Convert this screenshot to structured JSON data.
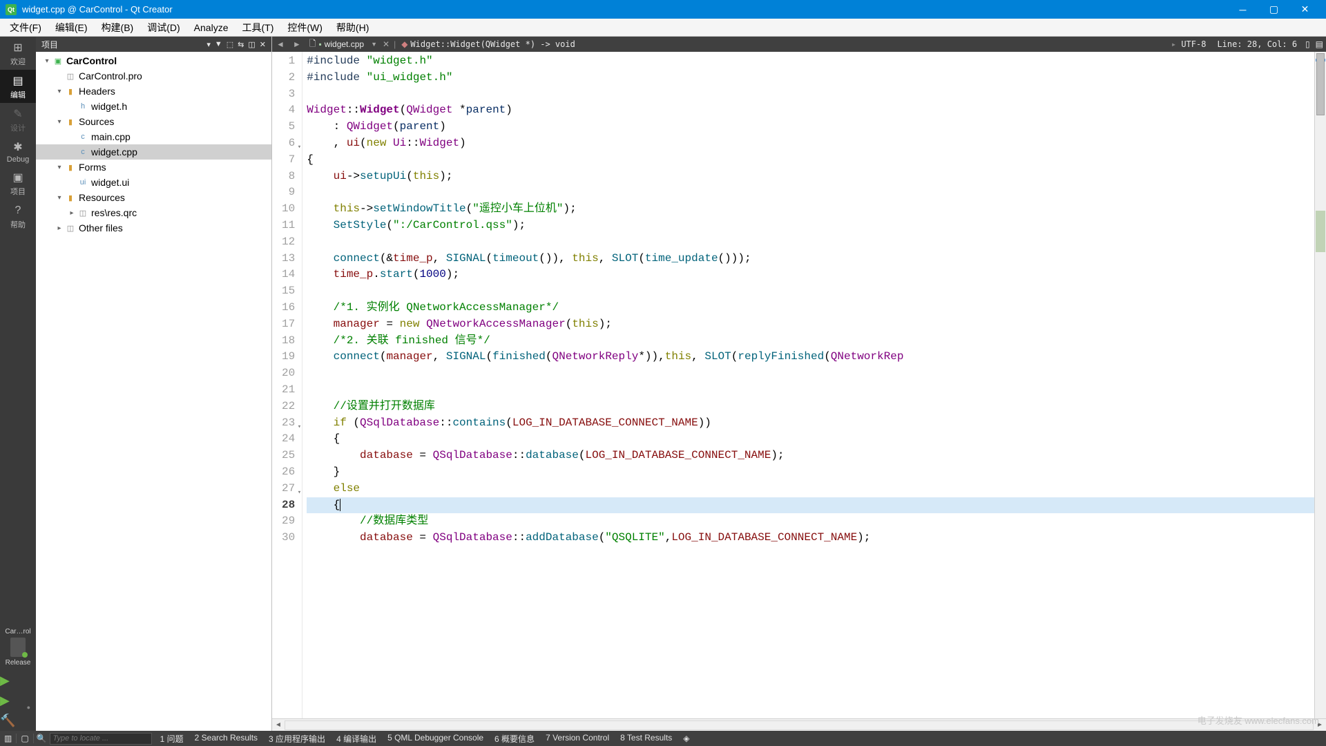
{
  "window": {
    "title": "widget.cpp @ CarControl - Qt Creator"
  },
  "menubar": [
    "文件(F)",
    "编辑(E)",
    "构建(B)",
    "调试(D)",
    "Analyze",
    "工具(T)",
    "控件(W)",
    "帮助(H)"
  ],
  "left_sidebar": {
    "items": [
      {
        "label": "欢迎",
        "icon": "⊞"
      },
      {
        "label": "编辑",
        "icon": "▤",
        "active": true
      },
      {
        "label": "设计",
        "icon": "✎",
        "disabled": true
      },
      {
        "label": "Debug",
        "icon": "✱"
      },
      {
        "label": "项目",
        "icon": "▣"
      },
      {
        "label": "帮助",
        "icon": "?"
      }
    ],
    "target_label": "Car…rol",
    "build_label": "Release"
  },
  "project_panel": {
    "title": "项目",
    "tree": [
      {
        "depth": 0,
        "toggle": "▾",
        "icon_cls": "icon-project",
        "icon": "▣",
        "label": "CarControl",
        "bold": true
      },
      {
        "depth": 1,
        "toggle": "",
        "icon_cls": "icon-file-generic",
        "icon": "◫",
        "label": "CarControl.pro"
      },
      {
        "depth": 1,
        "toggle": "▾",
        "icon_cls": "icon-folder",
        "icon": "▮",
        "label": "Headers"
      },
      {
        "depth": 2,
        "toggle": "",
        "icon_cls": "icon-file-h",
        "icon": "h",
        "label": "widget.h"
      },
      {
        "depth": 1,
        "toggle": "▾",
        "icon_cls": "icon-folder",
        "icon": "▮",
        "label": "Sources"
      },
      {
        "depth": 2,
        "toggle": "",
        "icon_cls": "icon-file-cpp",
        "icon": "c",
        "label": "main.cpp"
      },
      {
        "depth": 2,
        "toggle": "",
        "icon_cls": "icon-file-cpp",
        "icon": "c",
        "label": "widget.cpp",
        "selected": true
      },
      {
        "depth": 1,
        "toggle": "▾",
        "icon_cls": "icon-folder",
        "icon": "▮",
        "label": "Forms"
      },
      {
        "depth": 2,
        "toggle": "",
        "icon_cls": "icon-file-ui",
        "icon": "ui",
        "label": "widget.ui"
      },
      {
        "depth": 1,
        "toggle": "▾",
        "icon_cls": "icon-folder",
        "icon": "▮",
        "label": "Resources"
      },
      {
        "depth": 2,
        "toggle": "▸",
        "icon_cls": "icon-file-generic",
        "icon": "◫",
        "label": "res\\res.qrc"
      },
      {
        "depth": 1,
        "toggle": "▸",
        "icon_cls": "icon-file-generic",
        "icon": "◫",
        "label": "Other files"
      }
    ]
  },
  "editor_tabbar": {
    "file": "widget.cpp",
    "symbol": "Widget::Widget(QWidget *) -> void",
    "encoding": "UTF-8",
    "cursor": "Line: 28, Col: 6"
  },
  "code": {
    "current_line": 28,
    "fold_lines": [
      6,
      23,
      27
    ],
    "lines": [
      {
        "n": 1,
        "tokens": [
          [
            "tok-pre",
            "#include "
          ],
          [
            "tok-str",
            "\"widget.h\""
          ]
        ]
      },
      {
        "n": 2,
        "tokens": [
          [
            "tok-pre",
            "#include "
          ],
          [
            "tok-str",
            "\"ui_widget.h\""
          ]
        ]
      },
      {
        "n": 3,
        "tokens": [
          [
            "",
            ""
          ]
        ]
      },
      {
        "n": 4,
        "tokens": [
          [
            "tok-type",
            "Widget"
          ],
          [
            "tok-op",
            "::"
          ],
          [
            "tok-type tok-bold",
            "Widget"
          ],
          [
            "tok-op",
            "("
          ],
          [
            "tok-type",
            "QWidget"
          ],
          [
            "tok-op",
            " *"
          ],
          [
            "tok-local",
            "parent"
          ],
          [
            "tok-op",
            ")"
          ]
        ]
      },
      {
        "n": 5,
        "tokens": [
          [
            "",
            "    "
          ],
          [
            "tok-op",
            ": "
          ],
          [
            "tok-type",
            "QWidget"
          ],
          [
            "tok-op",
            "("
          ],
          [
            "tok-local",
            "parent"
          ],
          [
            "tok-op",
            ")"
          ]
        ]
      },
      {
        "n": 6,
        "tokens": [
          [
            "",
            "    "
          ],
          [
            "tok-op",
            ", "
          ],
          [
            "tok-member",
            "ui"
          ],
          [
            "tok-op",
            "("
          ],
          [
            "tok-kw",
            "new"
          ],
          [
            "tok-op",
            " "
          ],
          [
            "tok-type",
            "Ui"
          ],
          [
            "tok-op",
            "::"
          ],
          [
            "tok-type",
            "Widget"
          ],
          [
            "tok-op",
            ")"
          ]
        ]
      },
      {
        "n": 7,
        "tokens": [
          [
            "tok-op",
            "{"
          ]
        ]
      },
      {
        "n": 8,
        "tokens": [
          [
            "",
            "    "
          ],
          [
            "tok-member",
            "ui"
          ],
          [
            "tok-op",
            "->"
          ],
          [
            "tok-func",
            "setupUi"
          ],
          [
            "tok-op",
            "("
          ],
          [
            "tok-kw",
            "this"
          ],
          [
            "tok-op",
            ");"
          ]
        ]
      },
      {
        "n": 9,
        "tokens": [
          [
            "",
            ""
          ]
        ]
      },
      {
        "n": 10,
        "tokens": [
          [
            "",
            "    "
          ],
          [
            "tok-kw",
            "this"
          ],
          [
            "tok-op",
            "->"
          ],
          [
            "tok-func",
            "setWindowTitle"
          ],
          [
            "tok-op",
            "("
          ],
          [
            "tok-str",
            "\"遥控小车上位机\""
          ],
          [
            "tok-op",
            ");"
          ]
        ]
      },
      {
        "n": 11,
        "tokens": [
          [
            "",
            "    "
          ],
          [
            "tok-func",
            "SetStyle"
          ],
          [
            "tok-op",
            "("
          ],
          [
            "tok-str",
            "\":/CarControl.qss\""
          ],
          [
            "tok-op",
            ");"
          ]
        ]
      },
      {
        "n": 12,
        "tokens": [
          [
            "",
            ""
          ]
        ]
      },
      {
        "n": 13,
        "tokens": [
          [
            "",
            "    "
          ],
          [
            "tok-func",
            "connect"
          ],
          [
            "tok-op",
            "(&"
          ],
          [
            "tok-member",
            "time_p"
          ],
          [
            "tok-op",
            ", "
          ],
          [
            "tok-func",
            "SIGNAL"
          ],
          [
            "tok-op",
            "("
          ],
          [
            "tok-func",
            "timeout"
          ],
          [
            "tok-op",
            "()), "
          ],
          [
            "tok-kw",
            "this"
          ],
          [
            "tok-op",
            ", "
          ],
          [
            "tok-func",
            "SLOT"
          ],
          [
            "tok-op",
            "("
          ],
          [
            "tok-func",
            "time_update"
          ],
          [
            "tok-op",
            "()));"
          ]
        ]
      },
      {
        "n": 14,
        "tokens": [
          [
            "",
            "    "
          ],
          [
            "tok-member",
            "time_p"
          ],
          [
            "tok-op",
            "."
          ],
          [
            "tok-func",
            "start"
          ],
          [
            "tok-op",
            "("
          ],
          [
            "tok-num",
            "1000"
          ],
          [
            "tok-op",
            ");"
          ]
        ]
      },
      {
        "n": 15,
        "tokens": [
          [
            "",
            ""
          ]
        ]
      },
      {
        "n": 16,
        "tokens": [
          [
            "",
            "    "
          ],
          [
            "tok-comment",
            "/*1. 实例化 QNetworkAccessManager*/"
          ]
        ]
      },
      {
        "n": 17,
        "tokens": [
          [
            "",
            "    "
          ],
          [
            "tok-member",
            "manager"
          ],
          [
            "tok-op",
            " = "
          ],
          [
            "tok-kw",
            "new"
          ],
          [
            "tok-op",
            " "
          ],
          [
            "tok-type",
            "QNetworkAccessManager"
          ],
          [
            "tok-op",
            "("
          ],
          [
            "tok-kw",
            "this"
          ],
          [
            "tok-op",
            ");"
          ]
        ]
      },
      {
        "n": 18,
        "tokens": [
          [
            "",
            "    "
          ],
          [
            "tok-comment",
            "/*2. 关联 finished 信号*/"
          ]
        ]
      },
      {
        "n": 19,
        "tokens": [
          [
            "",
            "    "
          ],
          [
            "tok-func",
            "connect"
          ],
          [
            "tok-op",
            "("
          ],
          [
            "tok-member",
            "manager"
          ],
          [
            "tok-op",
            ", "
          ],
          [
            "tok-func",
            "SIGNAL"
          ],
          [
            "tok-op",
            "("
          ],
          [
            "tok-func",
            "finished"
          ],
          [
            "tok-op",
            "("
          ],
          [
            "tok-type",
            "QNetworkReply"
          ],
          [
            "tok-op",
            "*)),"
          ],
          [
            "tok-kw",
            "this"
          ],
          [
            "tok-op",
            ", "
          ],
          [
            "tok-func",
            "SLOT"
          ],
          [
            "tok-op",
            "("
          ],
          [
            "tok-func",
            "replyFinished"
          ],
          [
            "tok-op",
            "("
          ],
          [
            "tok-type",
            "QNetworkRep"
          ]
        ]
      },
      {
        "n": 20,
        "tokens": [
          [
            "",
            ""
          ]
        ]
      },
      {
        "n": 21,
        "tokens": [
          [
            "",
            ""
          ]
        ]
      },
      {
        "n": 22,
        "tokens": [
          [
            "",
            "    "
          ],
          [
            "tok-comment",
            "//设置并打开数据库"
          ]
        ]
      },
      {
        "n": 23,
        "tokens": [
          [
            "",
            "    "
          ],
          [
            "tok-kw",
            "if"
          ],
          [
            "tok-op",
            " ("
          ],
          [
            "tok-type",
            "QSqlDatabase"
          ],
          [
            "tok-op",
            "::"
          ],
          [
            "tok-func",
            "contains"
          ],
          [
            "tok-op",
            "("
          ],
          [
            "tok-member",
            "LOG_IN_DATABASE_CONNECT_NAME"
          ],
          [
            "tok-op",
            "))"
          ]
        ]
      },
      {
        "n": 24,
        "tokens": [
          [
            "",
            "    "
          ],
          [
            "tok-op",
            "{"
          ]
        ]
      },
      {
        "n": 25,
        "tokens": [
          [
            "",
            "        "
          ],
          [
            "tok-member",
            "database"
          ],
          [
            "tok-op",
            " = "
          ],
          [
            "tok-type",
            "QSqlDatabase"
          ],
          [
            "tok-op",
            "::"
          ],
          [
            "tok-func",
            "database"
          ],
          [
            "tok-op",
            "("
          ],
          [
            "tok-member",
            "LOG_IN_DATABASE_CONNECT_NAME"
          ],
          [
            "tok-op",
            ");"
          ]
        ]
      },
      {
        "n": 26,
        "tokens": [
          [
            "",
            "    "
          ],
          [
            "tok-op",
            "}"
          ]
        ]
      },
      {
        "n": 27,
        "tokens": [
          [
            "",
            "    "
          ],
          [
            "tok-kw",
            "else"
          ]
        ]
      },
      {
        "n": 28,
        "tokens": [
          [
            "",
            "    "
          ],
          [
            "tok-op",
            "{"
          ],
          [
            "cursor-bar",
            ""
          ]
        ]
      },
      {
        "n": 29,
        "tokens": [
          [
            "",
            "        "
          ],
          [
            "tok-comment",
            "//数据库类型"
          ]
        ]
      },
      {
        "n": 30,
        "tokens": [
          [
            "",
            "        "
          ],
          [
            "tok-member",
            "database"
          ],
          [
            "tok-op",
            " = "
          ],
          [
            "tok-type",
            "QSqlDatabase"
          ],
          [
            "tok-op",
            "::"
          ],
          [
            "tok-func",
            "addDatabase"
          ],
          [
            "tok-op",
            "("
          ],
          [
            "tok-str",
            "\"QSQLITE\""
          ],
          [
            "tok-op",
            ","
          ],
          [
            "tok-member",
            "LOG_IN_DATABASE_CONNECT_NAME"
          ],
          [
            "tok-op",
            ");"
          ]
        ]
      }
    ]
  },
  "statusbar": {
    "locate_placeholder": "Type to locate ...",
    "items": [
      "1 问题",
      "2 Search Results",
      "3 应用程序输出",
      "4 编译输出",
      "5 QML Debugger Console",
      "6 概要信息",
      "7 Version Control",
      "8 Test Results"
    ]
  },
  "watermark": "电子发烧友  www.elecfans.com"
}
